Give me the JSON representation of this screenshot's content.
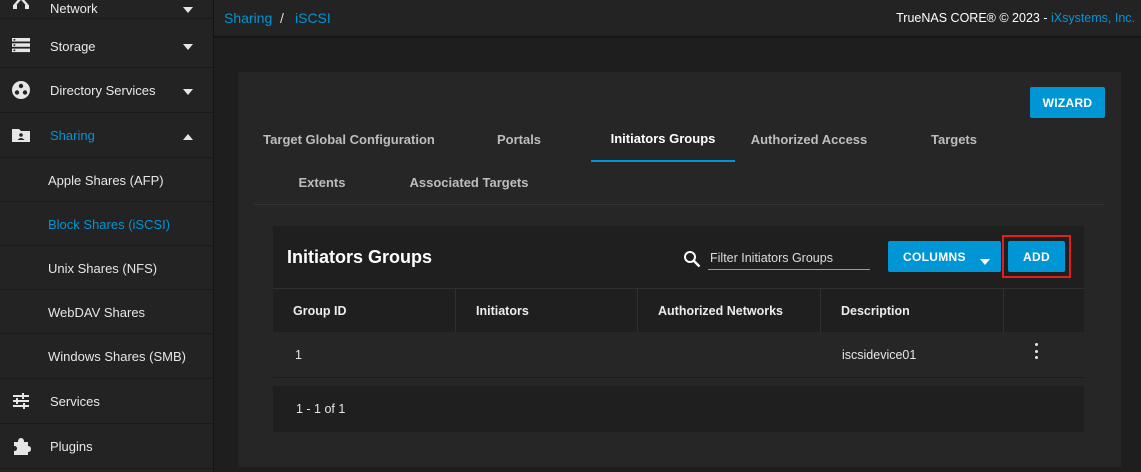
{
  "sidebar": {
    "items": [
      {
        "label": "Network",
        "icon": "network-icon",
        "arrow": "chevron-down-icon"
      },
      {
        "label": "Storage",
        "icon": "storage-icon",
        "arrow": "chevron-down-icon"
      },
      {
        "label": "Directory Services",
        "icon": "directory-services-icon",
        "arrow": "chevron-down-icon"
      },
      {
        "label": "Sharing",
        "icon": "sharing-folder-icon",
        "arrow": "chevron-up-icon"
      },
      {
        "label": "Services",
        "icon": "tune-icon"
      },
      {
        "label": "Plugins",
        "icon": "puzzle-icon"
      }
    ],
    "sharing_subitems": [
      {
        "label": "Apple Shares (AFP)"
      },
      {
        "label": "Block Shares (iSCSI)"
      },
      {
        "label": "Unix Shares (NFS)"
      },
      {
        "label": "WebDAV Shares"
      },
      {
        "label": "Windows Shares (SMB)"
      }
    ]
  },
  "header": {
    "breadcrumb": [
      "Sharing",
      "iSCSI"
    ],
    "breadcrumb_separator": "/",
    "copyright_text": "TrueNAS CORE® © 2023 - ",
    "copyright_link": "iXsystems, Inc."
  },
  "page": {
    "wizard_label": "WIZARD",
    "tabs": [
      {
        "label": "Target Global Configuration"
      },
      {
        "label": "Portals"
      },
      {
        "label": "Initiators Groups",
        "selected": true
      },
      {
        "label": "Authorized Access"
      },
      {
        "label": "Targets"
      },
      {
        "label": "Extents"
      },
      {
        "label": "Associated Targets"
      }
    ]
  },
  "table": {
    "title": "Initiators Groups",
    "filter_placeholder": "Filter Initiators Groups",
    "columns_label": "COLUMNS",
    "add_label": "ADD",
    "columns": [
      "Group ID",
      "Initiators",
      "Authorized Networks",
      "Description"
    ],
    "rows": [
      {
        "group_id": "1",
        "initiators": "",
        "authorized_networks": "",
        "description": "iscsidevice01"
      }
    ],
    "pager": "1 - 1 of 1"
  },
  "colors": {
    "accent": "#0095d5",
    "highlight": "#e0201f",
    "background": "#1e1e1e"
  }
}
